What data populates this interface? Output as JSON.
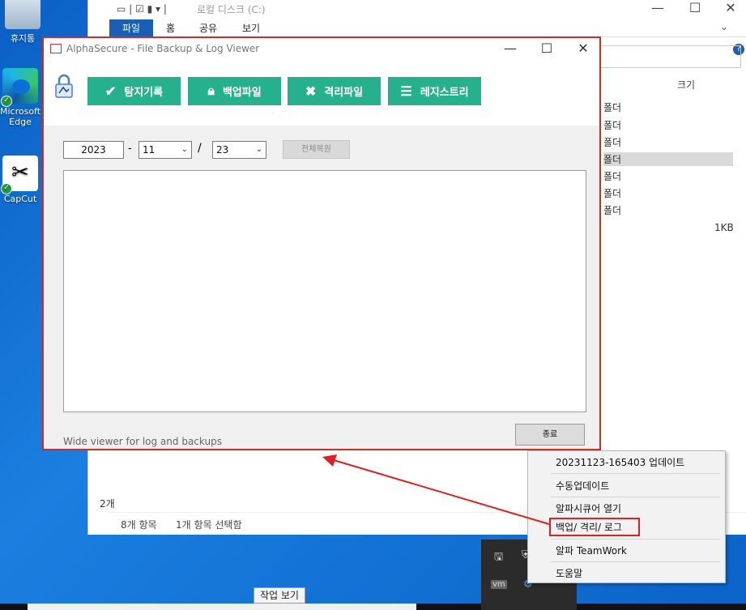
{
  "desktop": {
    "icons": [
      {
        "label": "휴지통",
        "icon": "recycle-bin-icon"
      },
      {
        "label": "Microsoft Edge",
        "icon": "edge-icon"
      },
      {
        "label": "CapCut",
        "icon": "capcut-icon"
      }
    ]
  },
  "explorer": {
    "title": "로컬 디스크 (C:)",
    "tabs": [
      "파일",
      "홈",
      "공유",
      "보기"
    ],
    "column_size": "크기",
    "folder_type": "폴더",
    "file_size": "1KB",
    "left_count": "2개",
    "status_items": "8개 항목",
    "status_selected": "1개 항목 선택함",
    "help": "?"
  },
  "app": {
    "title": "AlphaSecure - File Backup & Log Viewer",
    "toolbar": [
      {
        "label": "탐지기록",
        "icon": "checkmark-icon"
      },
      {
        "label": "백업파일",
        "icon": "lock-icon"
      },
      {
        "label": "격리파일",
        "icon": "x-icon"
      },
      {
        "label": "레지스트리",
        "icon": "menu-lines-icon"
      }
    ],
    "date": {
      "year": "2023",
      "month": "11",
      "day": "23",
      "dash": "-",
      "slash": "/"
    },
    "restore_all_label": "전체복원",
    "footer_text": "Wide viewer for log and backups",
    "close_label": "종료"
  },
  "context_menu": {
    "items": [
      "20231123-165403 업데이트",
      "수동업데이트",
      "알파시큐어 열기",
      "백업/ 격리/ 로그",
      "알파 TeamWork",
      "도움말"
    ],
    "highlighted_index": 3
  },
  "taskbar": {
    "tooltip": "작업 보기"
  },
  "colors": {
    "accent_green": "#25b08e",
    "highlight_red": "#d42a2a",
    "desktop_blue": "#0a63c8"
  }
}
